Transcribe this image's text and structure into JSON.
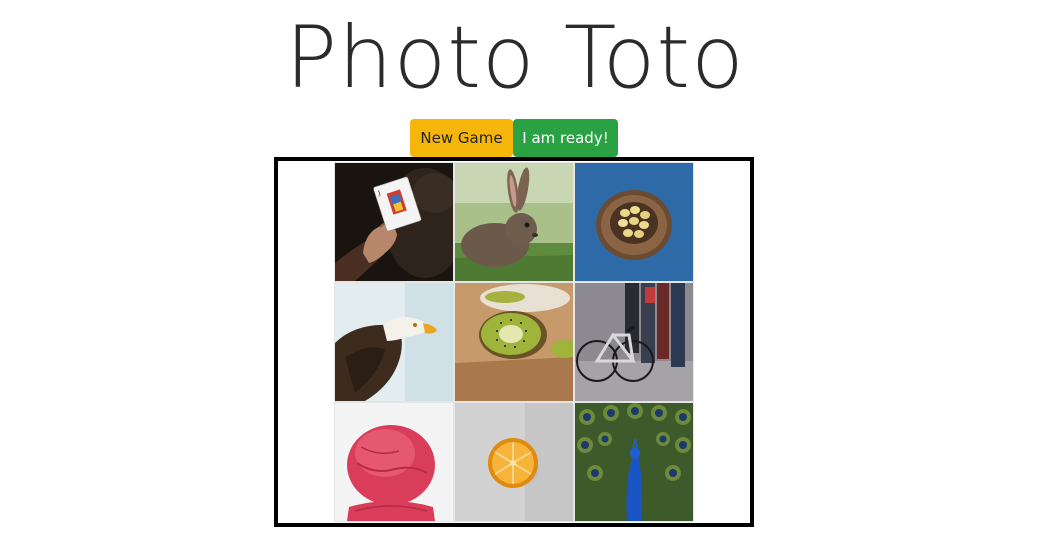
{
  "header": {
    "title": "Photo Toto"
  },
  "controls": {
    "new_game_label": "New Game",
    "ready_label": "I am ready!",
    "new_game_color": "#f5b50a",
    "ready_color": "#2aa244"
  },
  "board": {
    "tiles": [
      {
        "subject": "joker-card"
      },
      {
        "subject": "rabbit"
      },
      {
        "subject": "bird-nest-eggs"
      },
      {
        "subject": "eagle"
      },
      {
        "subject": "kiwi"
      },
      {
        "subject": "bicycle-street"
      },
      {
        "subject": "ice-cream"
      },
      {
        "subject": "orange-slice"
      },
      {
        "subject": "peacock"
      }
    ]
  }
}
